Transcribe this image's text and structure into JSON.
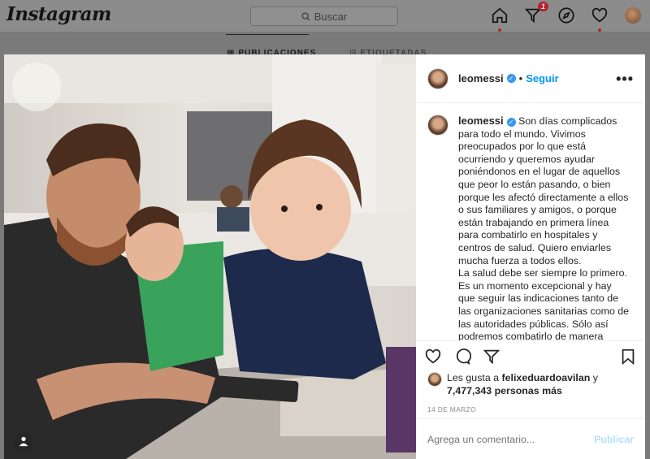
{
  "app": {
    "logo": "Instagram"
  },
  "search": {
    "placeholder": "Buscar"
  },
  "nav": {
    "notification_count": "1"
  },
  "profile_tabs": [
    {
      "label": "PUBLICACIONES"
    },
    {
      "label": "ETIQUETADAS"
    }
  ],
  "post": {
    "username": "leomessi",
    "follow_label": "Seguir",
    "separator": "•",
    "more_label": "•••",
    "caption_p1": "Son días complicados para todo el mundo. Vivimos preocupados por lo que está ocurriendo y queremos ayudar poniéndonos en el lugar de aquellos que peor lo están pasando, o bien porque les afectó directamente a ellos o sus familiares y amigos, o porque están trabajando en primera línea para combatirlo en hospitales y centros de salud. Quiero enviarles mucha fuerza a todos ellos.",
    "caption_p2": "La salud debe ser siempre lo primero. Es un momento excepcional y hay que seguir las indicaciones tanto de las organizaciones sanitarias como de las autoridades públicas. Sólo así podremos combatirlo de manera",
    "likes_prefix": "Les gusta a",
    "likes_user": "felixeduardoavilan",
    "likes_and": "y",
    "likes_count": "7,477,343 personas más",
    "date": "14 DE MARZO",
    "comment_placeholder": "Agrega un comentario...",
    "publish_label": "Publicar"
  },
  "colors": {
    "accent": "#0095f6",
    "publish_disabled": "#b2dffc",
    "badge": "#ed4956"
  },
  "icons": [
    "search-icon",
    "home-icon",
    "direct-icon",
    "explore-icon",
    "heart-icon",
    "like-icon",
    "comment-icon",
    "share-icon",
    "save-icon",
    "user-tag-icon",
    "verified-icon"
  ]
}
